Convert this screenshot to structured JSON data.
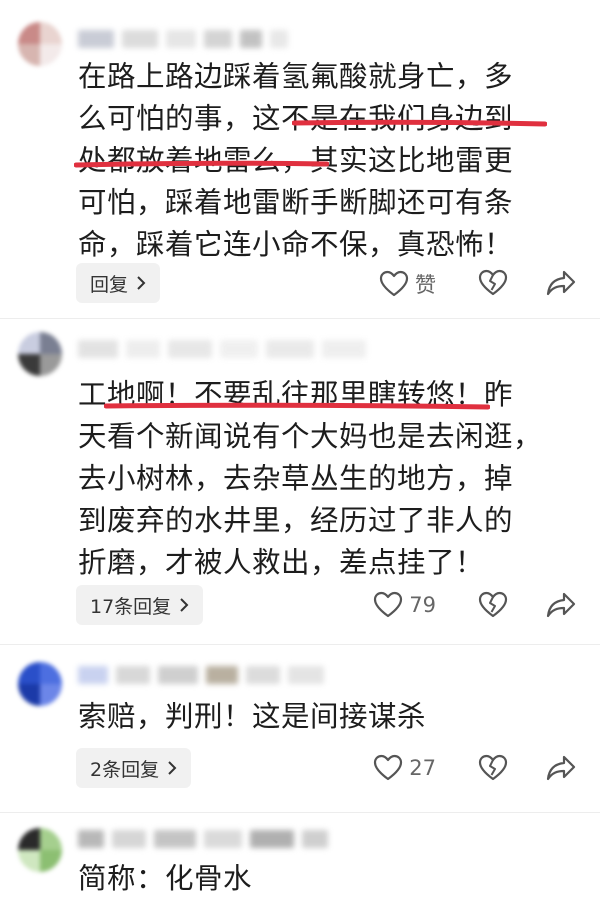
{
  "comments": [
    {
      "text": "在路上路边踩着氢氟酸就身亡，多\n么可怕的事，这不是在我们身边到\n处都放着地雷么，其实这比地雷更\n可怕，踩着地雷断手断脚还可有条\n命，踩着它连小命不保，真恐怖！",
      "reply_label": "回复",
      "like_label": "赞"
    },
    {
      "text": "工地啊！不要乱往那里瞎转悠！昨\n天看个新闻说有个大妈也是去闲逛，\n去小树林，去杂草丛生的地方，掉\n到废弃的水井里，经历过了非人的\n折磨，才被人救出，差点挂了！",
      "reply_label": "17条回复",
      "like_label": "79"
    },
    {
      "text": "索赔，判刑！这是间接谋杀",
      "reply_label": "2条回复",
      "like_label": "27"
    },
    {
      "text": "简称：化骨水"
    }
  ],
  "colors": {
    "underline": "#e0303f",
    "icon": "#555555",
    "reply_bg": "#f1f1f1"
  },
  "icons": [
    "heart-icon",
    "broken-heart-icon",
    "share-arrow-icon",
    "chevron-right-icon"
  ]
}
